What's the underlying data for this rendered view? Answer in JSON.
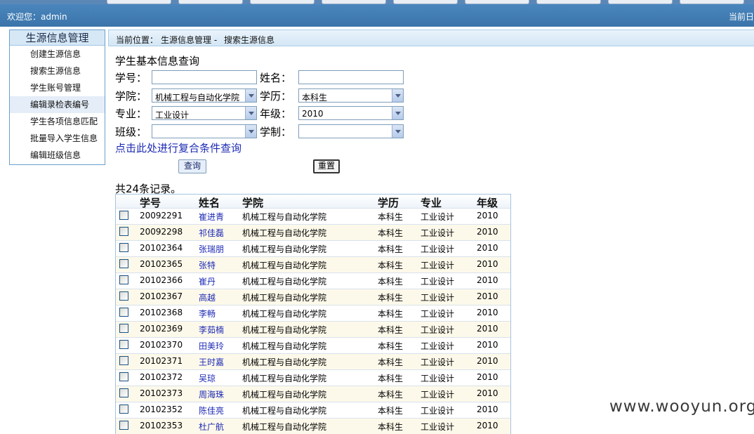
{
  "header": {
    "welcome": "欢迎您：admin",
    "date_label": "当前日"
  },
  "sidebar": {
    "title": "生源信息管理",
    "items": [
      {
        "label": "创建生源信息"
      },
      {
        "label": "搜索生源信息"
      },
      {
        "label": "学生账号管理"
      },
      {
        "label": "编辑录检表编号"
      },
      {
        "label": "学生各项信息匹配"
      },
      {
        "label": "批量导入学生信息"
      },
      {
        "label": "编辑班级信息"
      }
    ]
  },
  "breadcrumb": {
    "prefix": "当前位置：",
    "section": "生源信息管理 -",
    "page": "搜索生源信息"
  },
  "form": {
    "title": "学生基本信息查询",
    "student_id_label": "学号：",
    "student_id_value": "",
    "name_label": "姓名：",
    "name_value": "",
    "college_label": "学院：",
    "college_value": "机械工程与自动化学院",
    "degree_label": "学历：",
    "degree_value": "本科生",
    "major_label": "专业：",
    "major_value": "工业设计",
    "grade_label": "年级：",
    "grade_value": "2010",
    "class_label": "班级：",
    "class_value": "",
    "system_label": "学制：",
    "system_value": "",
    "advanced_link": "点击此处进行复合条件查询",
    "query_button": "查询",
    "reset_button": "重置"
  },
  "results": {
    "count_text": "共24条记录。",
    "columns": [
      "学号",
      "姓名",
      "学院",
      "学历",
      "专业",
      "年级"
    ],
    "rows": [
      {
        "id": "20092291",
        "name": "崔进青",
        "college": "机械工程与自动化学院",
        "degree": "本科生",
        "major": "工业设计",
        "grade": "2010"
      },
      {
        "id": "20092298",
        "name": "祁佳磊",
        "college": "机械工程与自动化学院",
        "degree": "本科生",
        "major": "工业设计",
        "grade": "2010"
      },
      {
        "id": "20102364",
        "name": "张瑞朋",
        "college": "机械工程与自动化学院",
        "degree": "本科生",
        "major": "工业设计",
        "grade": "2010"
      },
      {
        "id": "20102365",
        "name": "张特",
        "college": "机械工程与自动化学院",
        "degree": "本科生",
        "major": "工业设计",
        "grade": "2010"
      },
      {
        "id": "20102366",
        "name": "崔丹",
        "college": "机械工程与自动化学院",
        "degree": "本科生",
        "major": "工业设计",
        "grade": "2010"
      },
      {
        "id": "20102367",
        "name": "高越",
        "college": "机械工程与自动化学院",
        "degree": "本科生",
        "major": "工业设计",
        "grade": "2010"
      },
      {
        "id": "20102368",
        "name": "李畅",
        "college": "机械工程与自动化学院",
        "degree": "本科生",
        "major": "工业设计",
        "grade": "2010"
      },
      {
        "id": "20102369",
        "name": "李茹楠",
        "college": "机械工程与自动化学院",
        "degree": "本科生",
        "major": "工业设计",
        "grade": "2010"
      },
      {
        "id": "20102370",
        "name": "田美玲",
        "college": "机械工程与自动化学院",
        "degree": "本科生",
        "major": "工业设计",
        "grade": "2010"
      },
      {
        "id": "20102371",
        "name": "王时嘉",
        "college": "机械工程与自动化学院",
        "degree": "本科生",
        "major": "工业设计",
        "grade": "2010"
      },
      {
        "id": "20102372",
        "name": "吴琼",
        "college": "机械工程与自动化学院",
        "degree": "本科生",
        "major": "工业设计",
        "grade": "2010"
      },
      {
        "id": "20102373",
        "name": "周海珠",
        "college": "机械工程与自动化学院",
        "degree": "本科生",
        "major": "工业设计",
        "grade": "2010"
      },
      {
        "id": "20102352",
        "name": "陈佳亮",
        "college": "机械工程与自动化学院",
        "degree": "本科生",
        "major": "工业设计",
        "grade": "2010"
      },
      {
        "id": "20102353",
        "name": "杜广航",
        "college": "机械工程与自动化学院",
        "degree": "本科生",
        "major": "工业设计",
        "grade": "2010"
      }
    ]
  },
  "watermark": "www.wooyun.org"
}
